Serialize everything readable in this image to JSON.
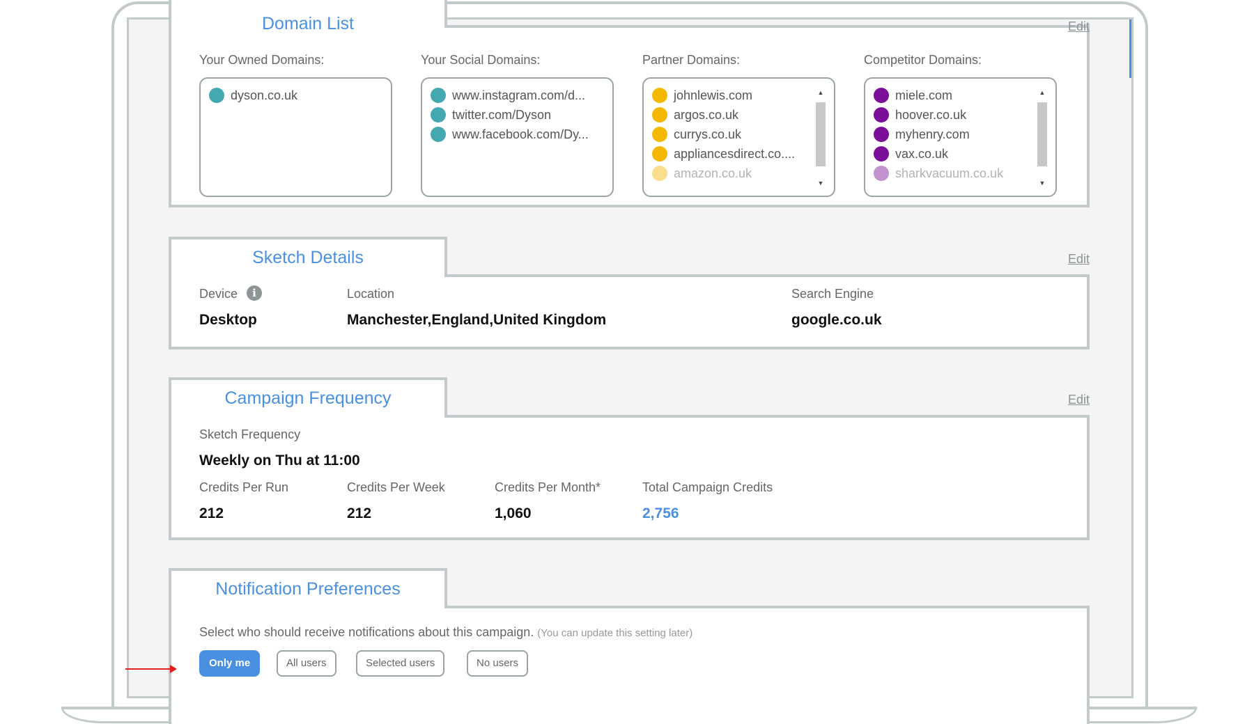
{
  "domain_list": {
    "title": "Domain List",
    "edit_label": "Edit",
    "owned": {
      "label": "Your Owned Domains:",
      "color": "#44a8b0",
      "items": [
        "dyson.co.uk"
      ]
    },
    "social": {
      "label": "Your Social Domains:",
      "color": "#44a8b0",
      "items": [
        "www.instagram.com/d...",
        "twitter.com/Dyson",
        "www.facebook.com/Dy..."
      ]
    },
    "partner": {
      "label": "Partner Domains:",
      "color": "#f5b800",
      "items": [
        "johnlewis.com",
        "argos.co.uk",
        "currys.co.uk",
        "appliancesdirect.co....",
        "amazon.co.uk"
      ]
    },
    "competitor": {
      "label": "Competitor Domains:",
      "color": "#7b0f9a",
      "items": [
        "miele.com",
        "hoover.co.uk",
        "myhenry.com",
        "vax.co.uk",
        "sharkvacuum.co.uk"
      ]
    }
  },
  "sketch_details": {
    "title": "Sketch Details",
    "edit_label": "Edit",
    "device_label": "Device",
    "device_value": "Desktop",
    "location_label": "Location",
    "location_value": "Manchester,England,United Kingdom",
    "engine_label": "Search Engine",
    "engine_value": "google.co.uk"
  },
  "campaign_frequency": {
    "title": "Campaign Frequency",
    "edit_label": "Edit",
    "frequency_label": "Sketch Frequency",
    "frequency_value": "Weekly on Thu at 11:00",
    "per_run_label": "Credits Per Run",
    "per_run_value": "212",
    "per_week_label": "Credits Per Week",
    "per_week_value": "212",
    "per_month_label": "Credits Per Month*",
    "per_month_value": "1,060",
    "total_label": "Total Campaign Credits",
    "total_value": "2,756"
  },
  "notification_preferences": {
    "title": "Notification Preferences",
    "prompt": "Select who should receive notifications about this campaign.",
    "hint": "(You can update this setting later)",
    "options": [
      "Only me",
      "All users",
      "Selected users",
      "No users"
    ],
    "selected": "Only me"
  },
  "colors": {
    "accent": "#4a90e2",
    "border": "#c3cacb",
    "annotation_arrow": "#e02020"
  }
}
